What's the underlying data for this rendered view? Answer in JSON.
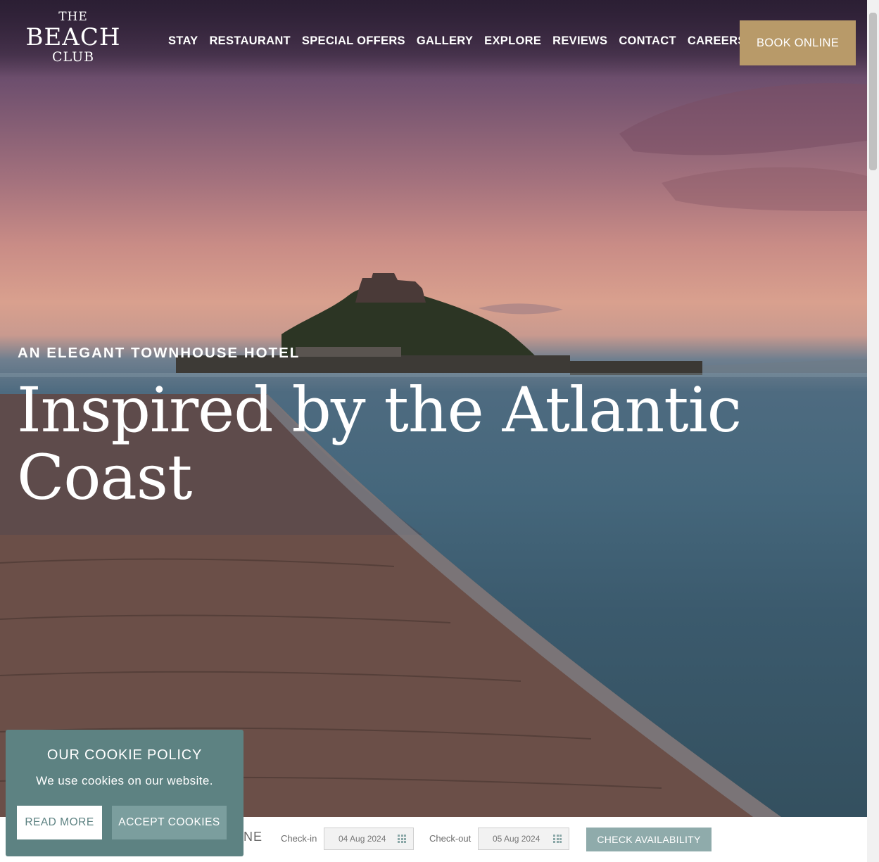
{
  "logo": {
    "the": "THE",
    "beach": "BEACH",
    "club": "CLUB"
  },
  "nav": {
    "items": [
      "STAY",
      "RESTAURANT",
      "SPECIAL OFFERS",
      "GALLERY",
      "EXPLORE",
      "REVIEWS",
      "CONTACT",
      "CAREERS"
    ],
    "book_online": "BOOK ONLINE"
  },
  "hero": {
    "eyebrow": "AN ELEGANT TOWNHOUSE HOTEL",
    "headline": "Inspired by the Atlantic Coast"
  },
  "booking": {
    "label_partial": "NE",
    "checkin_label": "Check-in",
    "checkin_value": "04 Aug 2024",
    "checkout_label": "Check-out",
    "checkout_value": "05 Aug 2024",
    "check_availability": "CHECK AVAILABILITY",
    "calendar_icon": "calendar-icon"
  },
  "cookie": {
    "title": "OUR COOKIE POLICY",
    "text": "We use cookies on our website.",
    "read_more": "READ MORE",
    "accept": "ACCEPT COOKIES"
  },
  "colors": {
    "gold": "#b89a69",
    "teal": "#5d8282",
    "teal_light": "#8fabab"
  }
}
